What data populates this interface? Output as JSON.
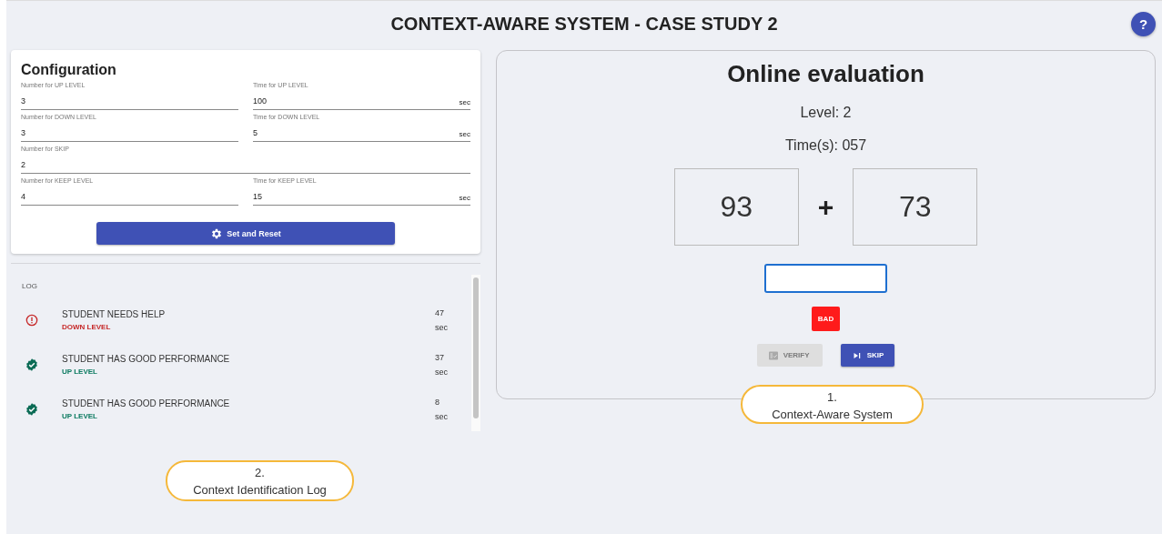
{
  "title": "CONTEXT-AWARE SYSTEM - CASE STUDY 2",
  "help_button": {
    "symbol": "?"
  },
  "configuration": {
    "title": "Configuration",
    "fields": [
      {
        "kind": "half",
        "label": "Number for UP LEVEL",
        "value": "3"
      },
      {
        "kind": "half",
        "label": "Time for UP LEVEL",
        "value": "100",
        "unit": "sec"
      },
      {
        "kind": "half",
        "label": "Number for DOWN LEVEL",
        "value": "3"
      },
      {
        "kind": "half",
        "label": "Time for DOWN LEVEL",
        "value": "5",
        "unit": "sec"
      },
      {
        "kind": "full",
        "label": "Number for SKIP",
        "value": "2"
      },
      {
        "kind": "half",
        "label": "Number for KEEP LEVEL",
        "value": "4"
      },
      {
        "kind": "half",
        "label": "Time for KEEP LEVEL",
        "value": "15",
        "unit": "sec"
      }
    ],
    "button": "Set and Reset"
  },
  "log": {
    "heading": "LOG",
    "entries": [
      {
        "kind": "warning",
        "message": "STUDENT NEEDS HELP",
        "action": "DOWN LEVEL",
        "time": "47",
        "unit": "sec"
      },
      {
        "kind": "success",
        "message": "STUDENT HAS GOOD PERFORMANCE",
        "action": "UP LEVEL",
        "time": "37",
        "unit": "sec"
      },
      {
        "kind": "success",
        "message": "STUDENT HAS GOOD PERFORMANCE",
        "action": "UP LEVEL",
        "time": "8",
        "unit": "sec"
      }
    ]
  },
  "evaluation": {
    "title": "Online evaluation",
    "level": "Level: 2",
    "time": "Time(s): 057",
    "operand_1": "93",
    "operator": "+",
    "operand_2": "73",
    "feedback": "BAD",
    "buttons": [
      {
        "kind": "verify",
        "label": "VERIFY",
        "disabled": true
      },
      {
        "kind": "skip",
        "label": "SKIP",
        "disabled": false
      }
    ]
  },
  "callouts": [
    {
      "number": "1.",
      "text": "Context-Aware System"
    },
    {
      "number": "2.",
      "text": "Context Identification Log"
    }
  ]
}
